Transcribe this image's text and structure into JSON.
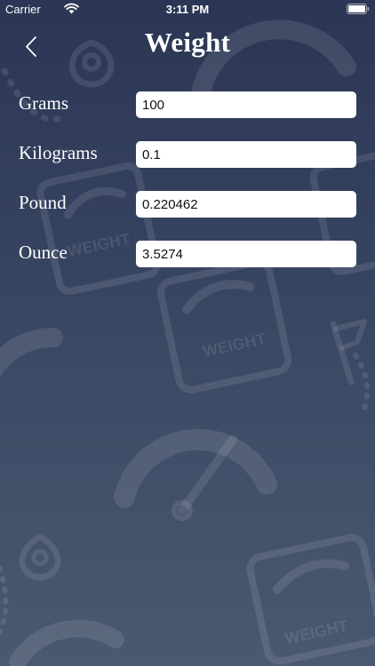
{
  "status_bar": {
    "carrier": "Carrier",
    "time": "3:11 PM"
  },
  "header": {
    "title": "Weight",
    "back_icon": "chevron-left-icon"
  },
  "conversions": [
    {
      "label": "Grams",
      "value": "100"
    },
    {
      "label": "Kilograms",
      "value": "0.1"
    },
    {
      "label": "Pound",
      "value": "0.220462"
    },
    {
      "label": "Ounce",
      "value": "3.5274"
    }
  ],
  "background": {
    "watermark_text": "WEIGHT",
    "colors": {
      "gradient_top": "#2b3654",
      "gradient_bottom": "#4a5870",
      "deco": "#ffffff"
    }
  }
}
